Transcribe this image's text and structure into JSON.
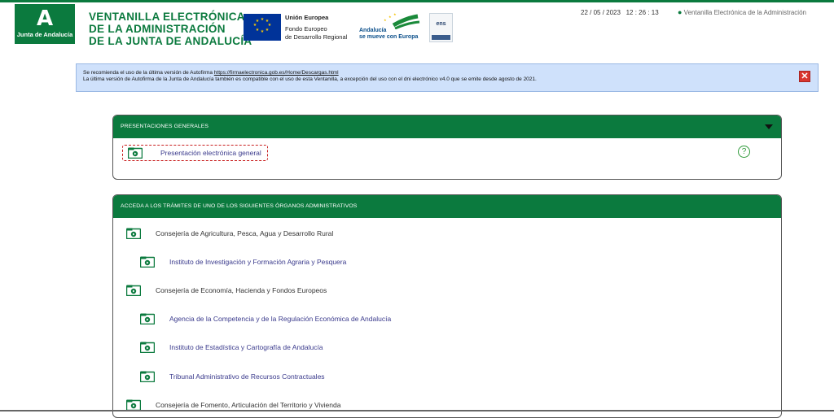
{
  "header": {
    "logo_letter": "A",
    "logo_text": "Junta de Andalucía",
    "title_lines": [
      "VENTANILLA ELECTRÓNICA",
      "DE LA ADMINISTRACIÓN",
      "DE LA JUNTA DE ANDALUCÍA"
    ],
    "eu_title": "Unión Europea",
    "eu_line1": "Fondo Europeo",
    "eu_line2": "de Desarrollo Regional",
    "andalucia_line1": "Andalucía",
    "andalucia_line2": "se mueve con Europa",
    "ens_label": "ens",
    "date": "22 / 05 / 2023",
    "time": "12 : 26 : 13",
    "location": "Ventanilla Electrónica de la Administración"
  },
  "notice": {
    "line1_prefix": "Se recomienda el uso de la última versión de Autofirma",
    "line1_link": "https://firmaelectronica.gob.es/Home/Descargas.html",
    "line2": "La última versión de Autofirma de la Junta de Andalucía también es compatible con el uso de esta Ventanilla, a excepción del uso con el dni electrónico v4.0 que se emite desde agosto de 2021."
  },
  "general": {
    "header": "PRESENTACIONES GENERALES",
    "item": "Presentación electrónica general",
    "help": "?"
  },
  "organos": {
    "header": "ACCEDA A LOS TRÁMITES DE UNO DE LOS SIGUIENTES ÓRGANOS ADMINISTRATIVOS",
    "items": [
      {
        "label": "Consejería de Agricultura, Pesca, Agua y Desarrollo Rural",
        "level": 0
      },
      {
        "label": "Instituto de Investigación y Formación Agraria y Pesquera",
        "level": 1
      },
      {
        "label": "Consejería de Economía, Hacienda y Fondos Europeos",
        "level": 0
      },
      {
        "label": "Agencia de la Competencia y de la Regulación Económica de Andalucía",
        "level": 1
      },
      {
        "label": "Instituto de Estadística y Cartografía de Andalucía",
        "level": 1
      },
      {
        "label": "Tribunal Administrativo de Recursos Contractuales",
        "level": 1
      },
      {
        "label": "Consejería de Fomento, Articulación del Territorio y Vivienda",
        "level": 0
      }
    ]
  },
  "colors": {
    "brand_green": "#0b7a3e",
    "notice_bg": "#cfe1fb",
    "close_red": "#d9362f"
  }
}
